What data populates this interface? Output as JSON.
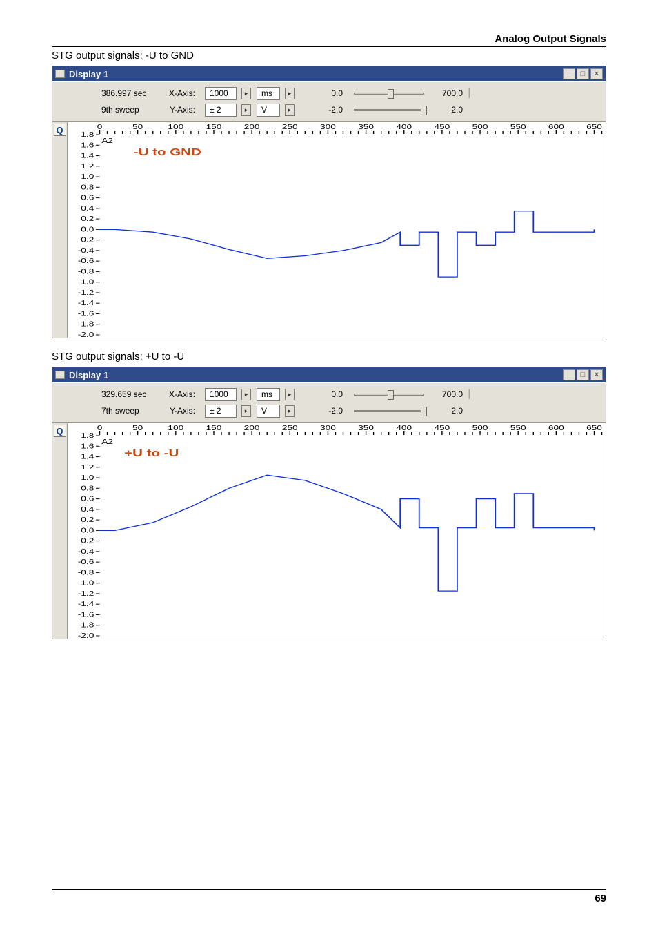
{
  "page": {
    "section_title": "Analog Output Signals",
    "page_number": "69",
    "caption1": "STG output signals: -U to GND",
    "caption2": "STG output signals: +U to -U"
  },
  "window1": {
    "title": "Display 1",
    "min_icon": "_",
    "max_icon": "□",
    "close_icon": "×",
    "toolbar": {
      "time": "386.997 sec",
      "sweep": "9th sweep",
      "xaxis_label": "X-Axis:",
      "yaxis_label": "Y-Axis:",
      "x_value": "1000",
      "x_unit": "ms",
      "y_value": "± 2",
      "y_unit": "V",
      "slider1_min": "0.0",
      "slider1_max": "700.0",
      "slider2_min": "-2.0",
      "slider2_max": "2.0"
    },
    "zoom_icon": "Q",
    "channel_label": "A2",
    "annotation": "-U to GND",
    "x_ticks": [
      "0",
      "50",
      "100",
      "150",
      "200",
      "250",
      "300",
      "350",
      "400",
      "450",
      "500",
      "550",
      "600",
      "650"
    ],
    "y_ticks": [
      "1.8",
      "1.6",
      "1.4",
      "1.2",
      "1.0",
      "0.8",
      "0.6",
      "0.4",
      "0.2",
      "0.0",
      "-0.2",
      "-0.4",
      "-0.6",
      "-0.8",
      "-1.0",
      "-1.2",
      "-1.4",
      "-1.6",
      "-1.8",
      "-2.0"
    ]
  },
  "window2": {
    "title": "Display 1",
    "min_icon": "_",
    "max_icon": "□",
    "close_icon": "×",
    "toolbar": {
      "time": "329.659 sec",
      "sweep": "7th sweep",
      "xaxis_label": "X-Axis:",
      "yaxis_label": "Y-Axis:",
      "x_value": "1000",
      "x_unit": "ms",
      "y_value": "± 2",
      "y_unit": "V",
      "slider1_min": "0.0",
      "slider1_max": "700.0",
      "slider2_min": "-2.0",
      "slider2_max": "2.0"
    },
    "zoom_icon": "Q",
    "channel_label": "A2",
    "annotation": "+U to -U",
    "x_ticks": [
      "0",
      "50",
      "100",
      "150",
      "200",
      "250",
      "300",
      "350",
      "400",
      "450",
      "500",
      "550",
      "600",
      "650"
    ],
    "y_ticks": [
      "1.8",
      "1.6",
      "1.4",
      "1.2",
      "1.0",
      "0.8",
      "0.6",
      "0.4",
      "0.2",
      "0.0",
      "-0.2",
      "-0.4",
      "-0.6",
      "-0.8",
      "-1.0",
      "-1.2",
      "-1.4",
      "-1.6",
      "-1.8",
      "-2.0"
    ]
  },
  "chart_data": [
    {
      "type": "line",
      "title": "-U to GND",
      "xlabel": "ms",
      "ylabel": "V",
      "xlim": [
        0,
        660
      ],
      "ylim": [
        -2.0,
        1.8
      ],
      "series": [
        {
          "name": "A2",
          "x": [
            0,
            20,
            70,
            120,
            170,
            220,
            270,
            320,
            370,
            395,
            395,
            420,
            420,
            445,
            445,
            470,
            470,
            495,
            495,
            520,
            520,
            545,
            545,
            570,
            570,
            650,
            650
          ],
          "y": [
            0.0,
            0.0,
            -0.05,
            -0.18,
            -0.38,
            -0.55,
            -0.5,
            -0.4,
            -0.25,
            -0.05,
            -0.3,
            -0.3,
            -0.05,
            -0.05,
            -0.9,
            -0.9,
            -0.05,
            -0.05,
            -0.3,
            -0.3,
            -0.05,
            -0.05,
            0.35,
            0.35,
            -0.05,
            -0.05,
            0.0
          ]
        }
      ]
    },
    {
      "type": "line",
      "title": "+U to -U",
      "xlabel": "ms",
      "ylabel": "V",
      "xlim": [
        0,
        660
      ],
      "ylim": [
        -2.0,
        1.8
      ],
      "series": [
        {
          "name": "A2",
          "x": [
            0,
            20,
            70,
            120,
            170,
            220,
            270,
            320,
            370,
            395,
            395,
            420,
            420,
            445,
            445,
            470,
            470,
            495,
            495,
            520,
            520,
            545,
            545,
            570,
            570,
            650,
            650
          ],
          "y": [
            0.0,
            0.0,
            0.15,
            0.45,
            0.8,
            1.05,
            0.95,
            0.7,
            0.4,
            0.05,
            0.6,
            0.6,
            0.05,
            0.05,
            -1.15,
            -1.15,
            0.05,
            0.05,
            0.6,
            0.6,
            0.05,
            0.05,
            0.7,
            0.7,
            0.05,
            0.05,
            0.0
          ]
        }
      ]
    }
  ]
}
